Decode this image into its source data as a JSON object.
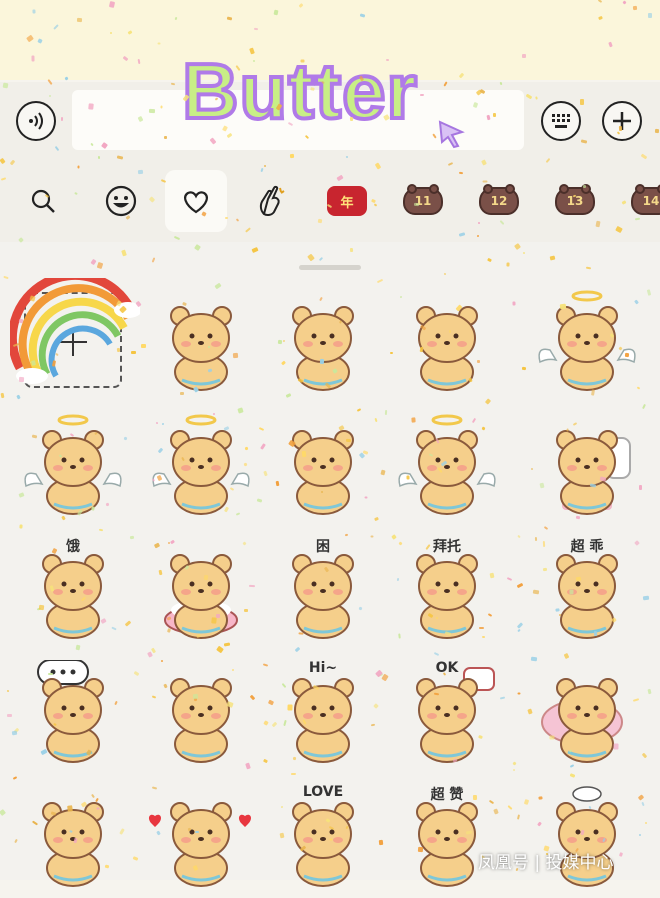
{
  "overlay": {
    "title": "Butter"
  },
  "input_bar": {
    "voice_icon": "voice-icon",
    "keyboard_icon": "keyboard-icon",
    "plus_icon": "plus-icon",
    "text_value": ""
  },
  "emoji_tabs": [
    {
      "icon": "search-icon",
      "label": ""
    },
    {
      "icon": "smiley-icon",
      "label": ""
    },
    {
      "icon": "heart-icon",
      "label": "",
      "selected": true
    },
    {
      "icon": "hand-icon",
      "label": ""
    },
    {
      "icon": "year-pack-icon",
      "label": "年"
    },
    {
      "icon": "bear-pack-icon",
      "label": "11"
    },
    {
      "icon": "bear-pack-icon",
      "label": "12"
    },
    {
      "icon": "bear-pack-icon",
      "label": "13"
    },
    {
      "icon": "bear-pack-icon",
      "label": "14"
    }
  ],
  "stickers": {
    "add_icon": "add-sticker-icon",
    "items": [
      {
        "icon": "rainbow-sticker"
      },
      {
        "icon": "bear-sticker"
      },
      {
        "icon": "bear-sticker"
      },
      {
        "icon": "bear-sticker"
      },
      {
        "icon": "bear-angel-sticker"
      },
      {
        "icon": "bear-angel-sticker"
      },
      {
        "icon": "bear-angel-sticker"
      },
      {
        "icon": "bear-sticker"
      },
      {
        "icon": "bear-angel-sticker"
      },
      {
        "icon": "bear-toilet-sticker"
      },
      {
        "icon": "bear-hungry-sticker",
        "text": "饿"
      },
      {
        "icon": "bear-rice-sticker"
      },
      {
        "icon": "bear-sleepy-sticker",
        "text": "困"
      },
      {
        "icon": "bear-please-sticker",
        "text": "拜托"
      },
      {
        "icon": "bear-good-sticker",
        "text": "超 乖"
      },
      {
        "icon": "bear-speech-sticker"
      },
      {
        "icon": "bear-question-sticker"
      },
      {
        "icon": "bear-hi-sticker",
        "text": "Hi~"
      },
      {
        "icon": "bear-ok-sticker",
        "text": "OK"
      },
      {
        "icon": "bear-pillow-sticker"
      },
      {
        "icon": "bear-donut-sticker"
      },
      {
        "icon": "bear-hearts-sticker"
      },
      {
        "icon": "bear-love-sticker",
        "text": "LOVE"
      },
      {
        "icon": "bear-praise-sticker",
        "text": "超 赞"
      },
      {
        "icon": "bear-rain-sticker"
      }
    ]
  },
  "watermark": "凤凰号 | 投媒中心",
  "colors": {
    "title_fill": "#c8ef86",
    "title_stroke": "#b07ae8",
    "bear_fill": "#f5cf8b",
    "bear_outline": "#8a5a3c",
    "blush": "#f59a8a"
  }
}
